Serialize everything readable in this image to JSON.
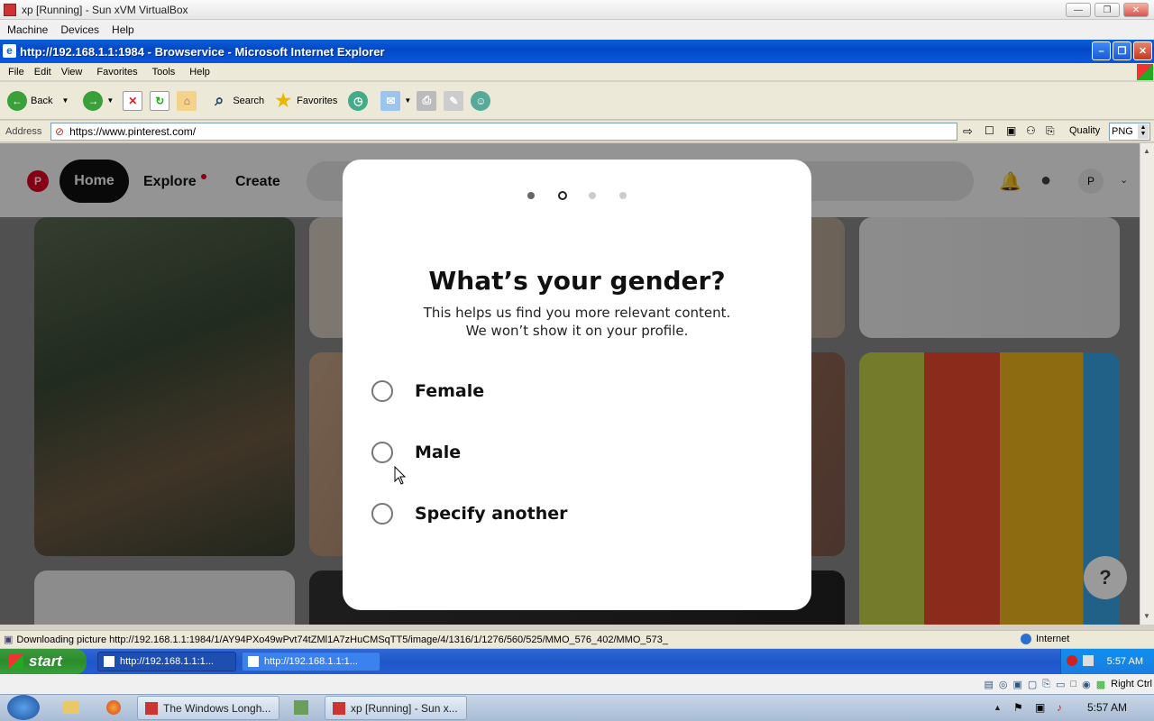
{
  "vbox": {
    "title": "xp [Running] - Sun xVM VirtualBox",
    "menu": [
      "Machine",
      "Devices",
      "Help"
    ],
    "status_hostkey": "Right Ctrl"
  },
  "ie": {
    "title": "http://192.168.1.1:1984 - Browservice - Microsoft Internet Explorer",
    "menu": [
      "File",
      "Edit",
      "View",
      "Favorites",
      "Tools",
      "Help"
    ],
    "toolbar": {
      "back": "Back",
      "search": "Search",
      "favorites": "Favorites"
    },
    "address_label": "Address",
    "url": "https://www.pinterest.com/",
    "quality_label": "Quality",
    "quality_value": "PNG",
    "status_text": "Downloading picture http://192.168.1.1:1984/1/AY94PXo49wPvt74tZMl1A7zHuCMSqTT5/image/4/1316/1/1276/560/525/MMO_576_402/MMO_573_",
    "zone": "Internet"
  },
  "pinterest": {
    "nav": {
      "home": "Home",
      "explore": "Explore",
      "create": "Create",
      "avatar": "P"
    },
    "help": "?"
  },
  "modal": {
    "progress_total": 4,
    "progress_current": 2,
    "title": "What’s your gender?",
    "subtitle_line1": "This helps us find you more relevant content.",
    "subtitle_line2": "We won’t show it on your profile.",
    "options": [
      "Female",
      "Male",
      "Specify another"
    ]
  },
  "xp_taskbar": {
    "start": "start",
    "tasks": [
      "http://192.168.1.1:1...",
      "http://192.168.1.1:1..."
    ],
    "clock": "5:57 AM"
  },
  "host_taskbar": {
    "windows": [
      "The Windows Longh...",
      "xp [Running] - Sun x..."
    ],
    "clock": "5:57 AM"
  }
}
